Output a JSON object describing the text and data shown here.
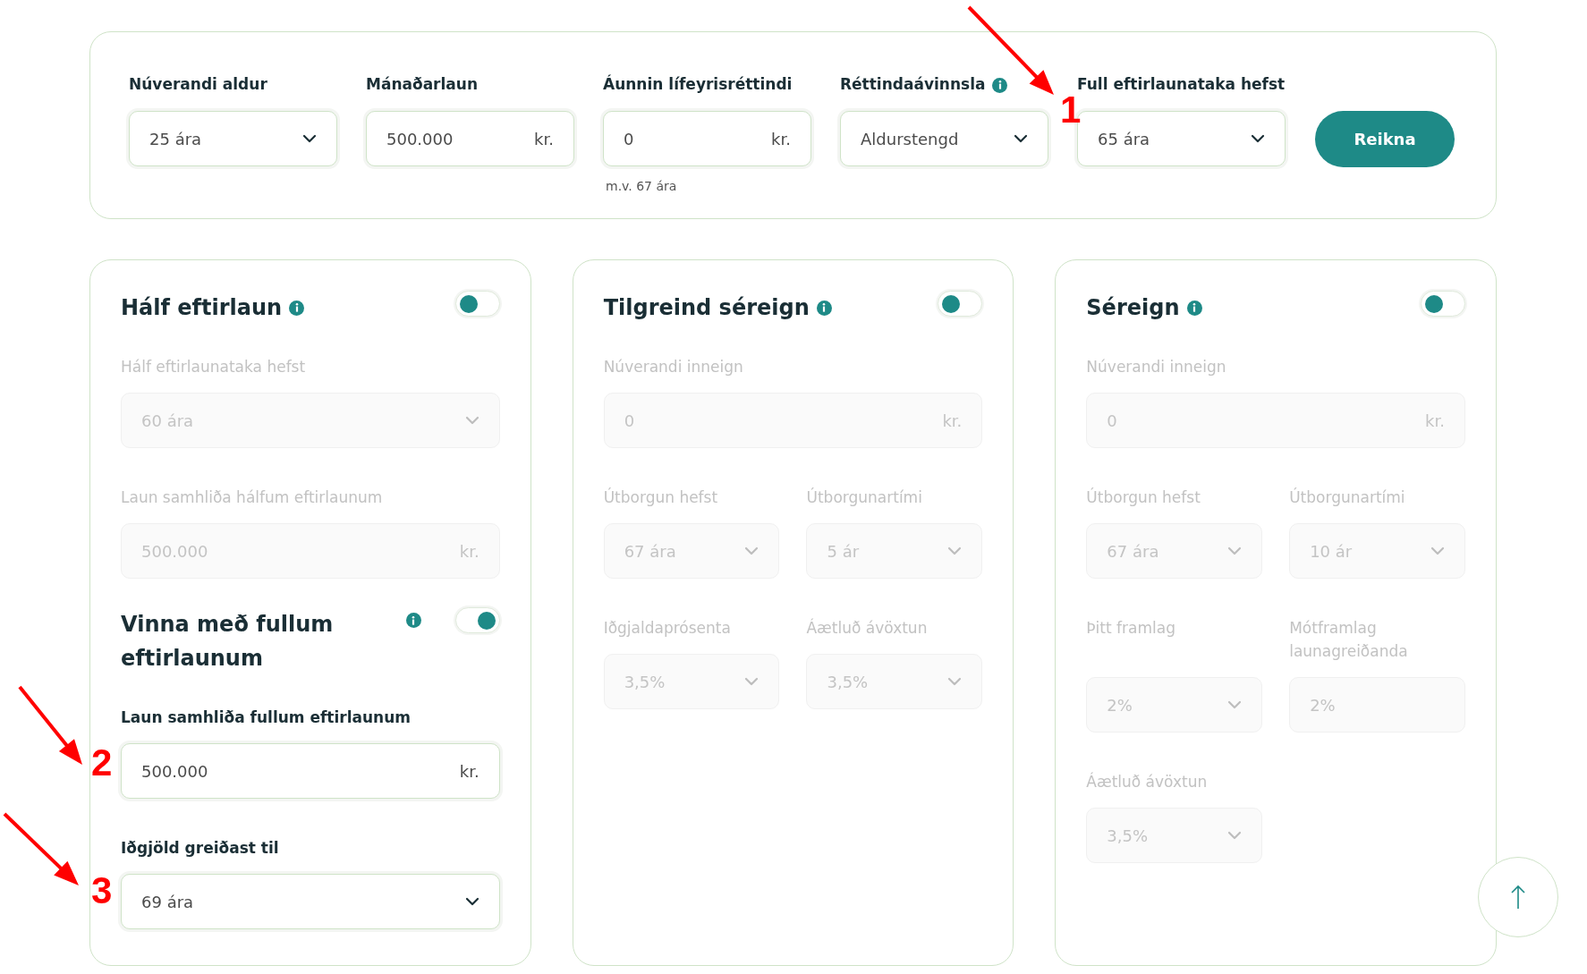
{
  "top": {
    "fields": [
      {
        "label": "Núverandi aldur",
        "kind": "select",
        "value": "25 ára"
      },
      {
        "label": "Mánaðarlaun",
        "kind": "money",
        "value": "500.000",
        "unit": "kr."
      },
      {
        "label": "Áunnin lífeyrisréttindi",
        "kind": "money",
        "value": "0",
        "unit": "kr.",
        "hint": "m.v. 67 ára"
      },
      {
        "label": "Réttindaávinnsla",
        "info": true,
        "kind": "select",
        "value": "Aldurstengd"
      },
      {
        "label": "Full eftirlaunataka hefst",
        "kind": "select",
        "value": "65 ára"
      }
    ],
    "button": "Reikna"
  },
  "cards": [
    {
      "sections": [
        {
          "title": "Hálf eftirlaun",
          "info": true,
          "on": false,
          "rows": [
            [
              {
                "label": "Hálf eftirlaunataka hefst",
                "kind": "select",
                "value": "60 ára"
              }
            ],
            [
              {
                "label": "Laun samhliða hálfum eftirlaunum",
                "kind": "money",
                "value": "500.000",
                "unit": "kr."
              }
            ]
          ]
        },
        {
          "title": "Vinna með fullum eftirlaunum",
          "info": true,
          "on": true,
          "rows": [
            [
              {
                "label": "Laun samhliða fullum eftirlaunum",
                "kind": "money",
                "value": "500.000",
                "unit": "kr."
              }
            ],
            [
              {
                "label": "Iðgjöld greiðast til",
                "kind": "select",
                "value": "69 ára"
              }
            ]
          ]
        }
      ]
    },
    {
      "sections": [
        {
          "title": "Tilgreind séreign",
          "info": true,
          "on": false,
          "rows": [
            [
              {
                "label": "Núverandi inneign",
                "kind": "money",
                "value": "0",
                "unit": "kr."
              }
            ],
            [
              {
                "label": "Útborgun hefst",
                "kind": "select",
                "value": "67 ára"
              },
              {
                "label": "Útborgunartími",
                "kind": "select",
                "value": "5 ár"
              }
            ],
            [
              {
                "label": "Iðgjaldaprósenta",
                "kind": "select",
                "value": "3,5%"
              },
              {
                "label": "Áætluð ávöxtun",
                "kind": "select",
                "value": "3,5%"
              }
            ]
          ]
        }
      ]
    },
    {
      "sections": [
        {
          "title": "Séreign",
          "info": true,
          "on": false,
          "rows": [
            [
              {
                "label": "Núverandi inneign",
                "kind": "money",
                "value": "0",
                "unit": "kr."
              }
            ],
            [
              {
                "label": "Útborgun hefst",
                "kind": "select",
                "value": "67 ára"
              },
              {
                "label": "Útborgunartími",
                "kind": "select",
                "value": "10 ár"
              }
            ],
            [
              {
                "label": "Þitt framlag",
                "kind": "select",
                "value": "2%"
              },
              {
                "label": "Mótframlag launagreiðanda",
                "kind": "text",
                "value": "2%"
              }
            ],
            [
              {
                "label": "Áætluð ávöxtun",
                "kind": "select",
                "value": "3,5%"
              }
            ]
          ]
        }
      ]
    }
  ],
  "annotations": [
    {
      "label": "1"
    },
    {
      "label": "2"
    },
    {
      "label": "3"
    }
  ]
}
